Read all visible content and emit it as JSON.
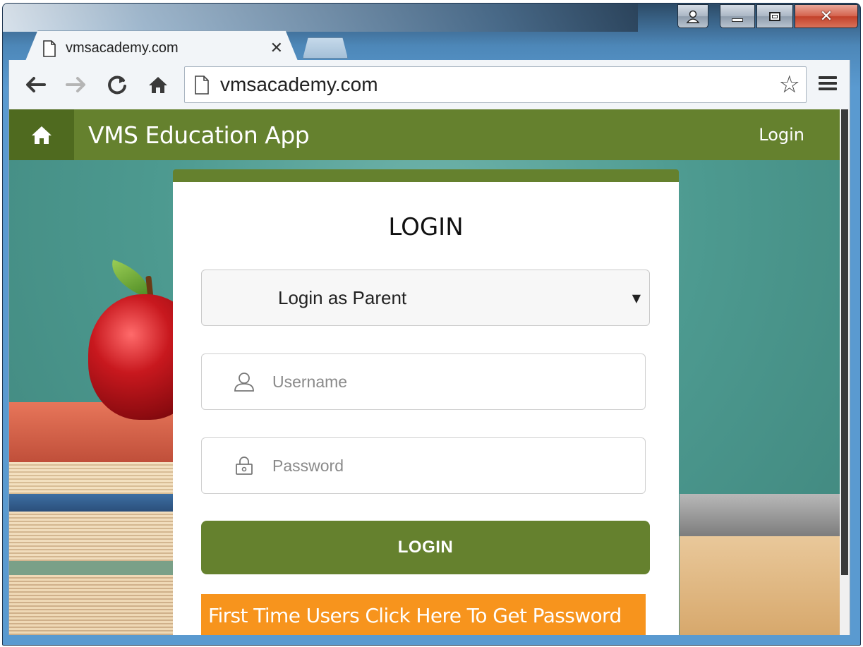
{
  "browser": {
    "tab_title": "vmsacademy.com",
    "tab_close": "✕",
    "address": "vmsacademy.com"
  },
  "app": {
    "brand": "VMS Education App",
    "nav_login": "Login",
    "colors": {
      "primary": "#65812e",
      "accent": "#f7941d"
    }
  },
  "login_card": {
    "title": "LOGIN",
    "role_select": {
      "selected": "Login as Parent"
    },
    "username": {
      "placeholder": "Username",
      "value": ""
    },
    "password": {
      "placeholder": "Password",
      "value": ""
    },
    "submit_label": "LOGIN",
    "first_time_link": "First Time Users Click Here To Get Password"
  },
  "icons": {
    "home": "home-icon",
    "user": "user-icon",
    "lock": "lock-icon",
    "star": "star-icon",
    "menu": "menu-icon"
  }
}
